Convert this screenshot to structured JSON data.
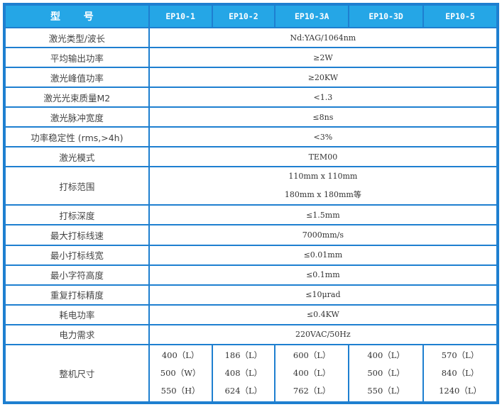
{
  "header": {
    "model_label": "型 号",
    "models": [
      "EP10-1",
      "EP10-2",
      "EP10-3A",
      "EP10-3D",
      "EP10-5"
    ]
  },
  "rows": [
    {
      "label": "激光类型/波长",
      "value": "Nd:YAG/1064nm"
    },
    {
      "label": "平均输出功率",
      "value": "≥2W"
    },
    {
      "label": "激光峰值功率",
      "value": "≥20KW"
    },
    {
      "label": "激光光束质量M2",
      "value": "<1.3"
    },
    {
      "label": "激光脉冲宽度",
      "value": "≤8ns"
    },
    {
      "label": "功率稳定性 (rms,>4h)",
      "value": "<3%"
    },
    {
      "label": "激光模式",
      "value": "TEM00"
    },
    {
      "label": "打标范围",
      "value_lines": [
        "110mm x 110mm",
        "180mm x 180mm等"
      ]
    },
    {
      "label": "打标深度",
      "value": "≤1.5mm"
    },
    {
      "label": "最大打标线速",
      "value": "7000mm/s"
    },
    {
      "label": "最小打标线宽",
      "value": "≤0.01mm"
    },
    {
      "label": "最小字符高度",
      "value": "≤0.1mm"
    },
    {
      "label": "重复打标精度",
      "value": "≤10μrad"
    },
    {
      "label": "耗电功率",
      "value": "≤0.4KW"
    },
    {
      "label": "电力需求",
      "value": "220VAC/50Hz"
    }
  ],
  "size": {
    "label": "整机尺寸",
    "columns": [
      [
        "400（L）",
        "500（W）",
        "550（H）"
      ],
      [
        "186（L）",
        "408（L）",
        "624（L）"
      ],
      [
        "600（L）",
        "400（L）",
        "762（L）"
      ],
      [
        "400（L）",
        "500（L）",
        "550（L）"
      ],
      [
        "570（L）",
        "840（L）",
        "1240（L）"
      ]
    ]
  }
}
